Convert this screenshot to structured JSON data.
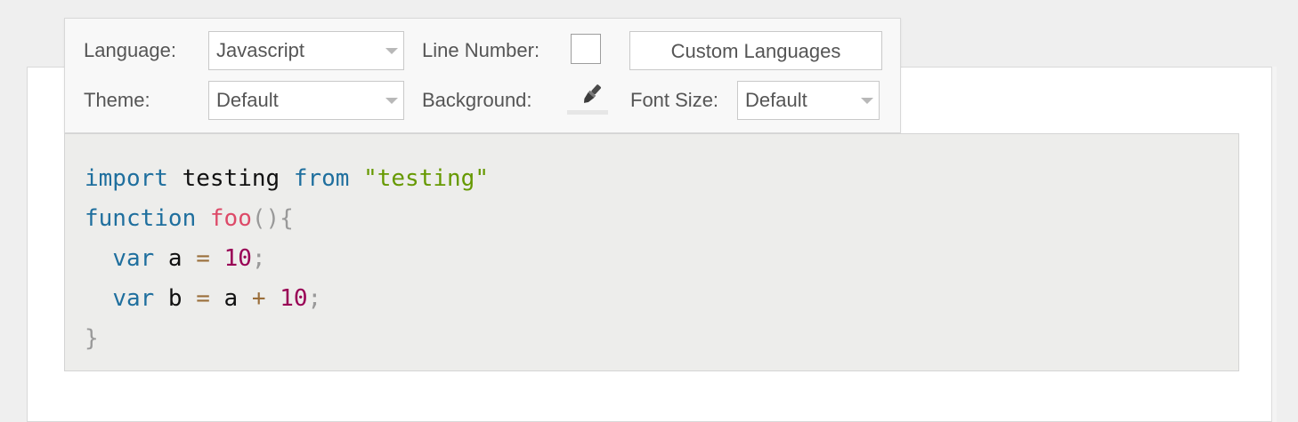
{
  "toolbar": {
    "language_label": "Language:",
    "language_value": "Javascript",
    "line_number_label": "Line Number:",
    "custom_languages_button": "Custom Languages",
    "theme_label": "Theme:",
    "theme_value": "Default",
    "background_label": "Background:",
    "background_icon": "paint-brush-icon",
    "font_size_label": "Font Size:",
    "font_size_value": "Default",
    "line_number_checked": false
  },
  "code": {
    "language": "javascript",
    "lines": [
      [
        {
          "t": "import",
          "c": "kw"
        },
        {
          "t": " testing ",
          "c": "ident"
        },
        {
          "t": "from",
          "c": "kw"
        },
        {
          "t": " ",
          "c": "ident"
        },
        {
          "t": "\"testing\"",
          "c": "str"
        }
      ],
      [
        {
          "t": "function",
          "c": "kw"
        },
        {
          "t": " ",
          "c": "ident"
        },
        {
          "t": "foo",
          "c": "fn"
        },
        {
          "t": "(){",
          "c": "punc"
        }
      ],
      [
        {
          "t": "  ",
          "c": "ident"
        },
        {
          "t": "var",
          "c": "kw"
        },
        {
          "t": " a ",
          "c": "ident"
        },
        {
          "t": "=",
          "c": "op"
        },
        {
          "t": " ",
          "c": "ident"
        },
        {
          "t": "10",
          "c": "num"
        },
        {
          "t": ";",
          "c": "punc"
        }
      ],
      [
        {
          "t": "  ",
          "c": "ident"
        },
        {
          "t": "var",
          "c": "kw"
        },
        {
          "t": " b ",
          "c": "ident"
        },
        {
          "t": "=",
          "c": "op"
        },
        {
          "t": " a ",
          "c": "ident"
        },
        {
          "t": "+",
          "c": "op"
        },
        {
          "t": " ",
          "c": "ident"
        },
        {
          "t": "10",
          "c": "num"
        },
        {
          "t": ";",
          "c": "punc"
        }
      ],
      [
        {
          "t": "}",
          "c": "punc"
        }
      ]
    ]
  },
  "colors": {
    "keyword": "#1f6f9e",
    "string": "#669900",
    "function": "#dd4a68",
    "number": "#990055",
    "operator": "#9a6e3a",
    "punctuation": "#999999",
    "code_background": "#ededeb"
  }
}
